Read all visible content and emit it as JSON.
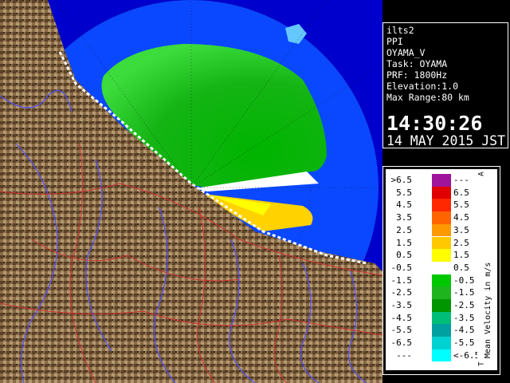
{
  "info": {
    "lines": [
      "ilts2",
      "PPI",
      "OYAMA_V",
      "Task: OYAMA",
      "PRF: 1800Hz",
      "Elevation:1.0",
      "Max Range:80 km"
    ],
    "time": "14:30:26",
    "date": "14 MAY 2015 JST"
  },
  "legend": {
    "title": "Mean Velocity in m/s",
    "corner_top": "A",
    "corner_bottom": "T",
    "rows": [
      {
        "lo": ">6.5",
        "hi": "---",
        "color": "#a0149b"
      },
      {
        "lo": "5.5",
        "hi": "6.5",
        "color": "#e10000"
      },
      {
        "lo": "4.5",
        "hi": "5.5",
        "color": "#ff2800"
      },
      {
        "lo": "3.5",
        "hi": "4.5",
        "color": "#ff6400"
      },
      {
        "lo": "2.5",
        "hi": "3.5",
        "color": "#ff9900"
      },
      {
        "lo": "1.5",
        "hi": "2.5",
        "color": "#ffc800"
      },
      {
        "lo": "0.5",
        "hi": "1.5",
        "color": "#ffff00"
      },
      {
        "lo": "-0.5",
        "hi": "0.5",
        "color": "#ffffff"
      },
      {
        "lo": "-1.5",
        "hi": "-0.5",
        "color": "#00c800"
      },
      {
        "lo": "-2.5",
        "hi": "-1.5",
        "color": "#1eb41e"
      },
      {
        "lo": "-3.5",
        "hi": "-2.5",
        "color": "#009600"
      },
      {
        "lo": "-4.5",
        "hi": "-3.5",
        "color": "#00be78"
      },
      {
        "lo": "-5.5",
        "hi": "-4.5",
        "color": "#00a0a0"
      },
      {
        "lo": "-6.5",
        "hi": "-5.5",
        "color": "#00d2d2"
      },
      {
        "lo": "---",
        "hi": "<-6.5",
        "color": "#00ffff"
      }
    ]
  },
  "colors": {
    "sea_far": "#0a48ff",
    "sea_near": "#1e64ff",
    "land": "#8a6a46",
    "radar_green": "#32c832",
    "radar_yellow": "#ffd200",
    "rivers": "#5050ff",
    "roads": "#d23232"
  }
}
